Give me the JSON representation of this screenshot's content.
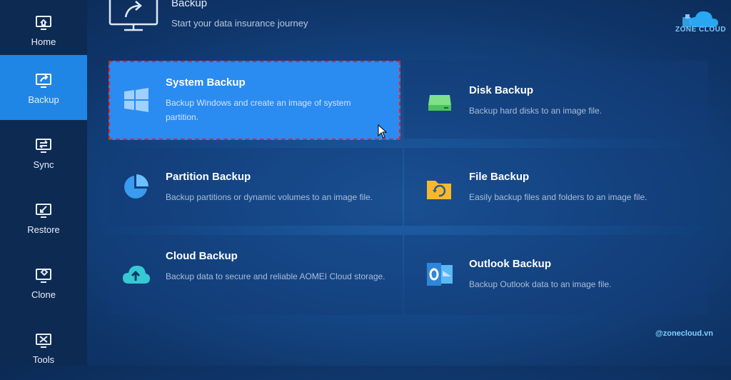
{
  "sidebar": {
    "items": [
      {
        "label": "Home",
        "icon": "home-icon"
      },
      {
        "label": "Backup",
        "icon": "backup-icon",
        "active": true
      },
      {
        "label": "Sync",
        "icon": "sync-icon"
      },
      {
        "label": "Restore",
        "icon": "restore-icon"
      },
      {
        "label": "Clone",
        "icon": "clone-icon"
      },
      {
        "label": "Tools",
        "icon": "tools-icon"
      }
    ]
  },
  "header": {
    "title": "Backup",
    "subtitle": "Start your data insurance journey"
  },
  "logo": {
    "text": "ZONE CLOUD"
  },
  "watermark": "@zonecloud.vn",
  "cards": [
    {
      "title": "System Backup",
      "desc": "Backup Windows and create an image of system partition.",
      "icon": "windows-icon",
      "selected": true
    },
    {
      "title": "Disk Backup",
      "desc": "Backup hard disks to an image file.",
      "icon": "disk-icon"
    },
    {
      "title": "Partition Backup",
      "desc": "Backup partitions or dynamic volumes to an image file.",
      "icon": "partition-icon"
    },
    {
      "title": "File Backup",
      "desc": "Easily backup files and folders to an image file.",
      "icon": "folder-icon"
    },
    {
      "title": "Cloud Backup",
      "desc": "Backup data to secure and reliable AOMEI Cloud storage.",
      "icon": "cloud-upload-icon"
    },
    {
      "title": "Outlook Backup",
      "desc": "Backup Outlook data to an image file.",
      "icon": "outlook-icon"
    }
  ],
  "colors": {
    "accent": "#1f86e6",
    "selected_card": "#2a8bf0",
    "selection_outline": "#e0232e",
    "sidebar": "#0d2a52"
  }
}
